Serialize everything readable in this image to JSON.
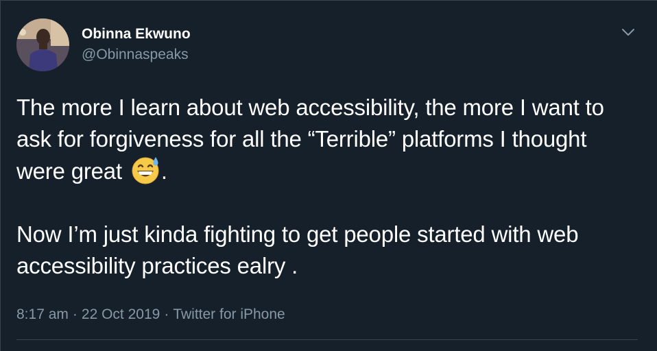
{
  "user": {
    "display_name": "Obinna Ekwuno",
    "handle": "@Obinnaspeaks"
  },
  "tweet": {
    "paragraph1_before_emoji": "The more I learn about web accessibility, the more I want to ask for forgiveness for all the “Terrible” platforms I thought were great ",
    "emoji": "grinning-face-with-sweat",
    "paragraph1_after_emoji": ".",
    "paragraph2": "Now I’m just kinda fighting to get people started with web accessibility practices ealry ."
  },
  "meta": {
    "time": "8:17 am",
    "separator": "·",
    "date": "22 Oct 2019",
    "source": "Twitter for iPhone"
  },
  "icons": {
    "menu": "chevron-down-icon"
  },
  "colors": {
    "background": "#15202b",
    "text": "#ffffff",
    "secondary_text": "#8899a6",
    "border": "#38444d"
  }
}
